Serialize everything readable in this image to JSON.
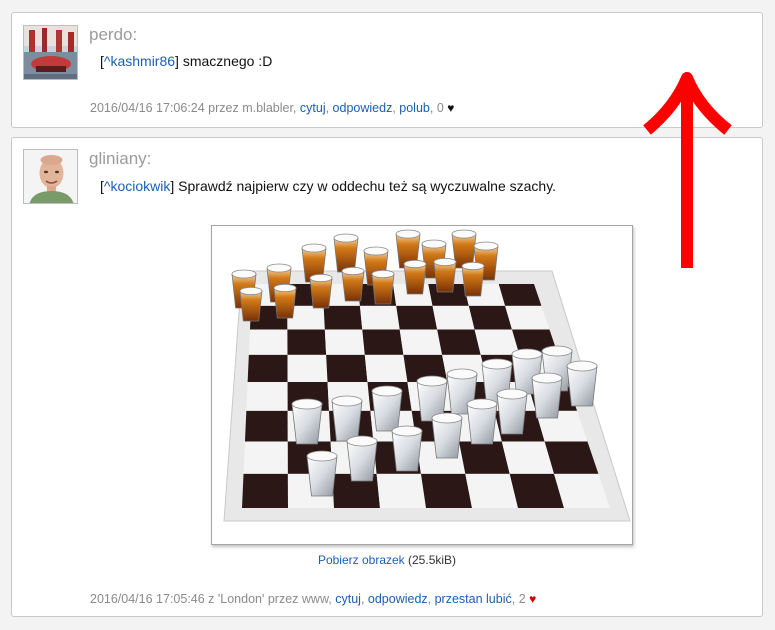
{
  "comments": [
    {
      "author": "perdo:",
      "mention": "[^kashmir86]",
      "mention_user": "^kashmir86",
      "text": "smacznego :D",
      "meta_prefix": "2016/04/16 17:06:24 przez m.blabler,",
      "actions": [
        "cytuj",
        "odpowiedz",
        "polub"
      ],
      "likes": "0",
      "heart_color": "#111111"
    },
    {
      "author": "gliniany:",
      "mention_user": "^kociokwik",
      "text": "Sprawdź najpierw czy w oddechu też są wyczuwalne szachy.",
      "meta_prefix": "2016/04/16 17:05:46 z 'London' przez www,",
      "actions": [
        "cytuj",
        "odpowiedz",
        "przestan lubić"
      ],
      "likes": "2",
      "heart_color": "#d40000",
      "image_caption_link": "Pobierz obrazek",
      "image_caption_size": "(25.5kiB)"
    }
  ],
  "accent_color": "#1a5fb4",
  "arrow_color": "#ff0000",
  "icons": [
    "heart-icon",
    "up-arrow-icon"
  ]
}
